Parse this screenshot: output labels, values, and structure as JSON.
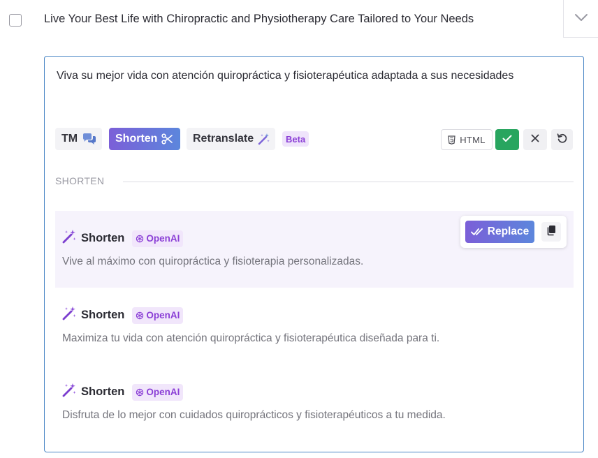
{
  "source": {
    "text": "Live Your Best Life with Chiropractic and Physiotherapy Care Tailored to Your Needs"
  },
  "translation": {
    "text": "Viva su mejor vida con atención quiropráctica y fisioterapéutica adaptada a sus necesidades"
  },
  "toolbar": {
    "tm_label": "TM",
    "shorten_label": "Shorten",
    "retranslate_label": "Retranslate",
    "beta_label": "Beta",
    "html_label": "HTML"
  },
  "section": {
    "label": "SHORTEN"
  },
  "suggestions": [
    {
      "title": "Shorten",
      "provider": "OpenAI",
      "text": "Vive al máximo con quiropráctica y fisioterapia personalizadas."
    },
    {
      "title": "Shorten",
      "provider": "OpenAI",
      "text": "Maximiza tu vida con atención quiropráctica y fisioterapéutica diseñada para ti."
    },
    {
      "title": "Shorten",
      "provider": "OpenAI",
      "text": "Disfruta de lo mejor con cuidados quiroprácticos y fisioterapéuticos a tu medida."
    }
  ],
  "actions": {
    "replace_label": "Replace"
  },
  "colors": {
    "accent_gradient_start": "#7b5fd8",
    "accent_gradient_end": "#5c86dc",
    "accept_green": "#28a55f",
    "badge_purple": "#8b3fd6",
    "editor_border": "#4a86c5"
  },
  "icons": {
    "tm": "chat-bubbles-icon",
    "shorten": "scissors-icon",
    "retranslate": "magic-wand-icon",
    "html": "html5-shield-icon",
    "accept": "check-icon",
    "reject": "close-icon",
    "reset": "undo-icon",
    "replace": "double-check-icon",
    "copy": "copy-icon",
    "expand": "chevron-down-icon",
    "openai": "openai-logo-icon"
  }
}
